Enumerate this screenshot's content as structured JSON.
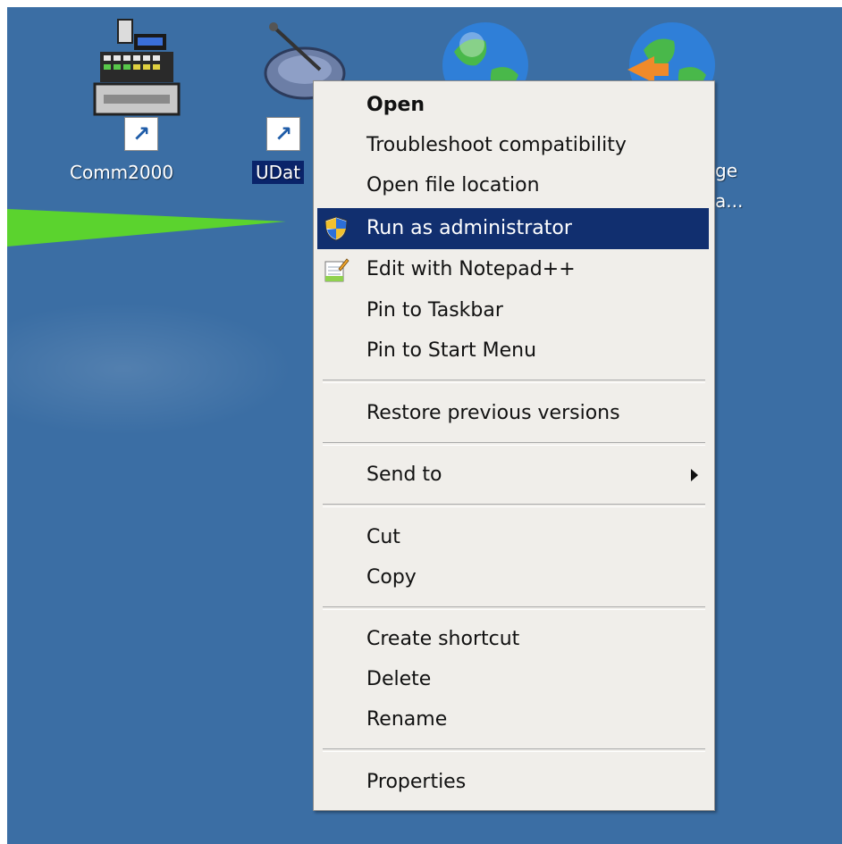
{
  "desktop": {
    "icons": [
      {
        "label": "Comm2000"
      },
      {
        "label": "UDat"
      },
      {
        "label": ""
      },
      {
        "label": "ge"
      },
      {
        "label": "a..."
      }
    ]
  },
  "context_menu": {
    "items": [
      {
        "label": "Open",
        "bold": true
      },
      {
        "label": "Troubleshoot compatibility"
      },
      {
        "label": "Open file location"
      },
      {
        "label": "Run as administrator",
        "icon": "uac-shield-icon",
        "highlighted": true
      },
      {
        "label": "Edit with Notepad++",
        "icon": "notepad-plus-plus-icon"
      },
      {
        "label": "Pin to Taskbar"
      },
      {
        "label": "Pin to Start Menu"
      },
      {
        "label": "Restore previous versions"
      },
      {
        "label": "Send to",
        "submenu": true
      },
      {
        "label": "Cut"
      },
      {
        "label": "Copy"
      },
      {
        "label": "Create shortcut"
      },
      {
        "label": "Delete"
      },
      {
        "label": "Rename"
      },
      {
        "label": "Properties"
      }
    ]
  },
  "colors": {
    "desktop_bg": "#3b6ea4",
    "menu_bg": "#f0eeea",
    "highlight": "#112f6f",
    "arrow": "#5bd32e"
  }
}
